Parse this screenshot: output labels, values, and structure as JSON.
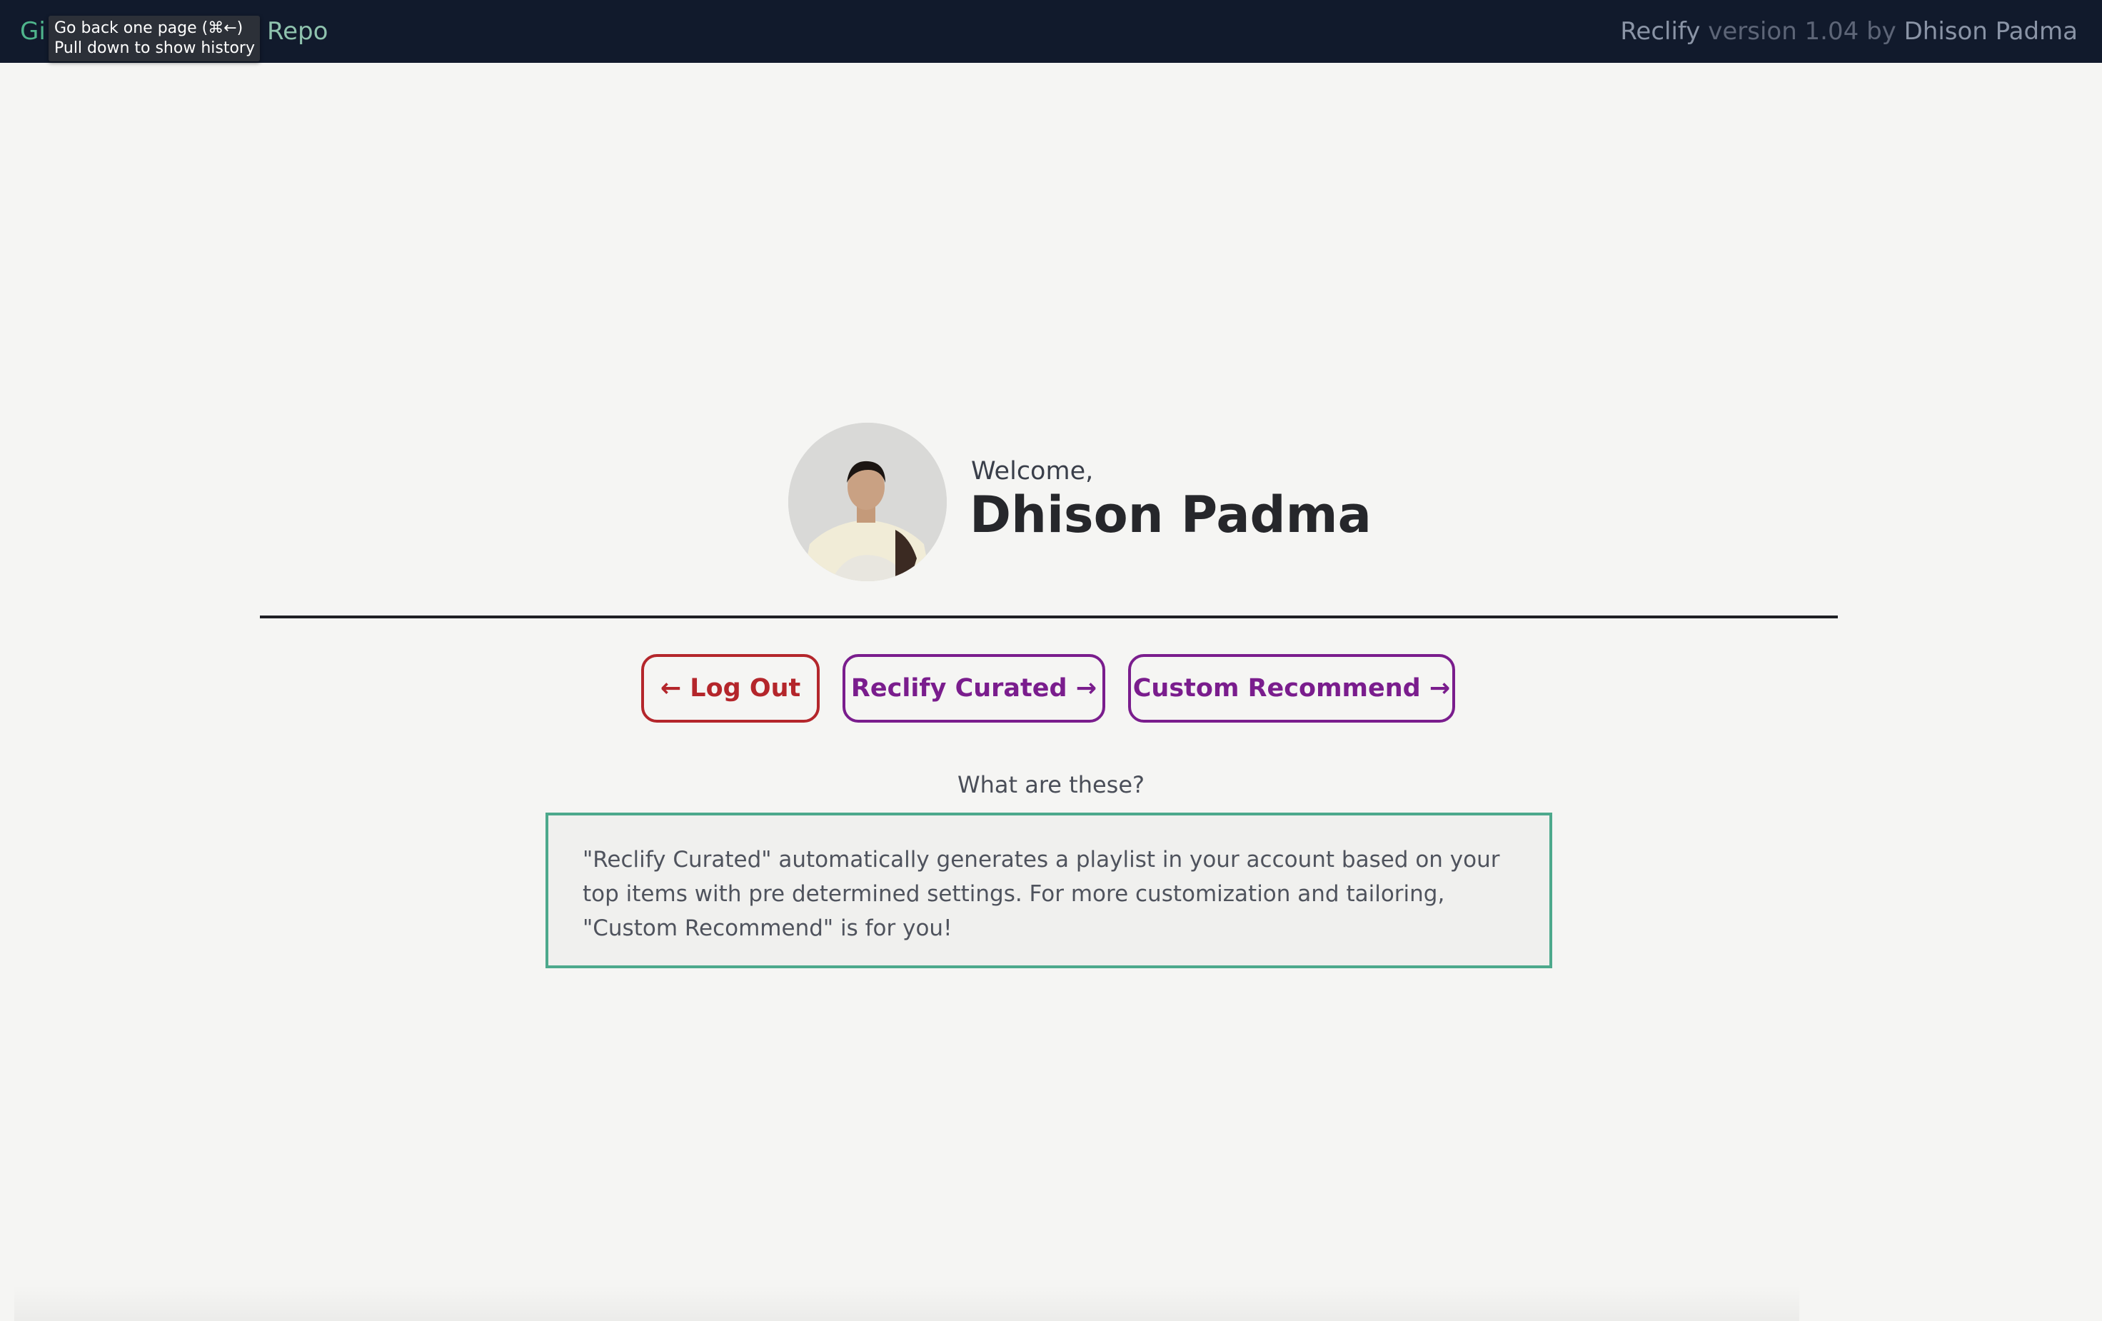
{
  "nav": {
    "github_label": "Gi",
    "repo_label": "Repo"
  },
  "tooltip": {
    "line1": "Go back one page (⌘←)",
    "line2": "Pull down to show history"
  },
  "version": {
    "app": "Reclify",
    "version_text": "version 1.04 by",
    "author": "Dhison Padma"
  },
  "profile": {
    "welcome": "Welcome,",
    "name": "Dhison Padma"
  },
  "buttons": {
    "logout": "← Log Out",
    "curated": "Reclify Curated →",
    "custom": "Custom Recommend →"
  },
  "info": {
    "question": "What are these?",
    "description": "\"Reclify Curated\" automatically generates a playlist in your account based on your top items with pre determined settings. For more customization and tailoring, \"Custom Recommend\" is for you!"
  },
  "colors": {
    "topbar": "#111a2c",
    "accent_purple": "#7a1d8d",
    "logout_red": "#b4262b",
    "info_border": "#4da98c"
  }
}
